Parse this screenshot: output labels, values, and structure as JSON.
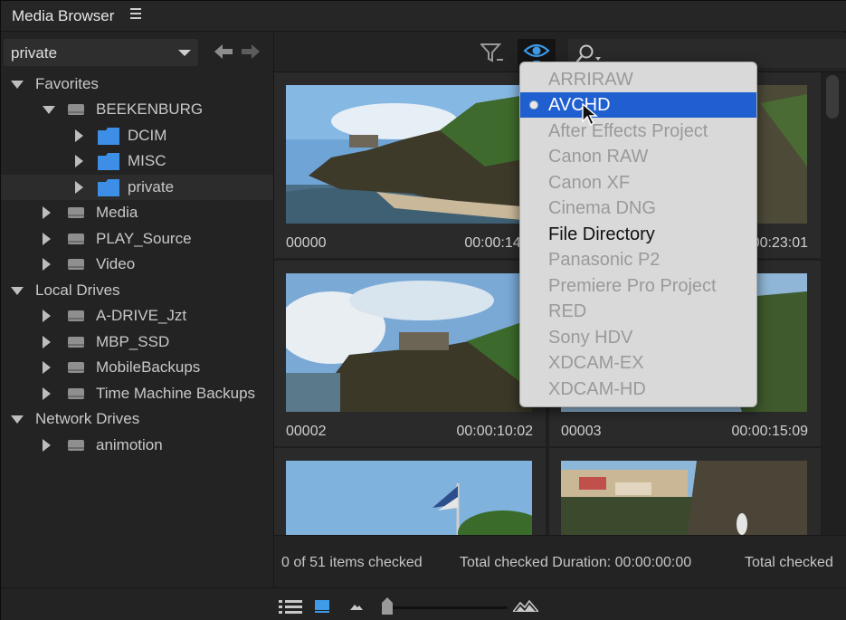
{
  "panel": {
    "title": "Media Browser"
  },
  "toolbar": {
    "location": "private",
    "back_icon": "arrow-left-icon",
    "forward_icon": "arrow-right-icon",
    "filter_icon": "filter-icon",
    "view_icon": "eye-icon",
    "search_icon": "search-icon"
  },
  "tree": [
    {
      "label": "Favorites",
      "kind": "header",
      "expanded": true
    },
    {
      "label": "BEEKENBURG",
      "kind": "drive",
      "expanded": true
    },
    {
      "label": "DCIM",
      "kind": "folder"
    },
    {
      "label": "MISC",
      "kind": "folder"
    },
    {
      "label": "private",
      "kind": "folder",
      "selected": true
    },
    {
      "label": "Media",
      "kind": "drive"
    },
    {
      "label": "PLAY_Source",
      "kind": "drive"
    },
    {
      "label": "Video",
      "kind": "drive"
    },
    {
      "label": "Local Drives",
      "kind": "header",
      "expanded": true
    },
    {
      "label": "A-DRIVE_Jzt",
      "kind": "drive"
    },
    {
      "label": "MBP_SSD",
      "kind": "drive"
    },
    {
      "label": "MobileBackups",
      "kind": "drive"
    },
    {
      "label": "Time Machine Backups",
      "kind": "drive"
    },
    {
      "label": "Network Drives",
      "kind": "header",
      "expanded": true
    },
    {
      "label": "animotion",
      "kind": "drive"
    }
  ],
  "clips": [
    {
      "name": "00000",
      "duration": "00:00:14:2"
    },
    {
      "name": "",
      "duration": "0:00:23:01"
    },
    {
      "name": "00002",
      "duration": "00:00:10:02"
    },
    {
      "name": "00003",
      "duration": "00:00:15:09"
    },
    {
      "name": "",
      "duration": ""
    },
    {
      "name": "",
      "duration": ""
    }
  ],
  "status": {
    "checked": "0 of 51 items checked",
    "duration": "Total checked Duration: 00:00:00:00",
    "overflow": "Total checked"
  },
  "view_menu": {
    "items": [
      {
        "label": "ARRIRAW",
        "enabled": false
      },
      {
        "label": "AVCHD",
        "enabled": true,
        "selected": true,
        "highlighted": true
      },
      {
        "label": "After Effects Project",
        "enabled": false
      },
      {
        "label": "Canon RAW",
        "enabled": false
      },
      {
        "label": "Canon XF",
        "enabled": false
      },
      {
        "label": "Cinema DNG",
        "enabled": false
      },
      {
        "label": "File Directory",
        "enabled": true
      },
      {
        "label": "Panasonic P2",
        "enabled": false
      },
      {
        "label": "Premiere Pro Project",
        "enabled": false
      },
      {
        "label": "RED",
        "enabled": false
      },
      {
        "label": "Sony HDV",
        "enabled": false
      },
      {
        "label": "XDCAM-EX",
        "enabled": false
      },
      {
        "label": "XDCAM-HD",
        "enabled": false
      }
    ]
  },
  "bottom": {
    "list_view_icon": "list-view-icon",
    "icon_view_icon": "icon-view-icon",
    "zoom_small_icon": "mountain-small-icon",
    "zoom_large_icon": "mountain-large-icon",
    "zoom_level": 0.05
  },
  "colors": {
    "accent": "#1f5fd0",
    "folder": "#3d8ee6"
  }
}
